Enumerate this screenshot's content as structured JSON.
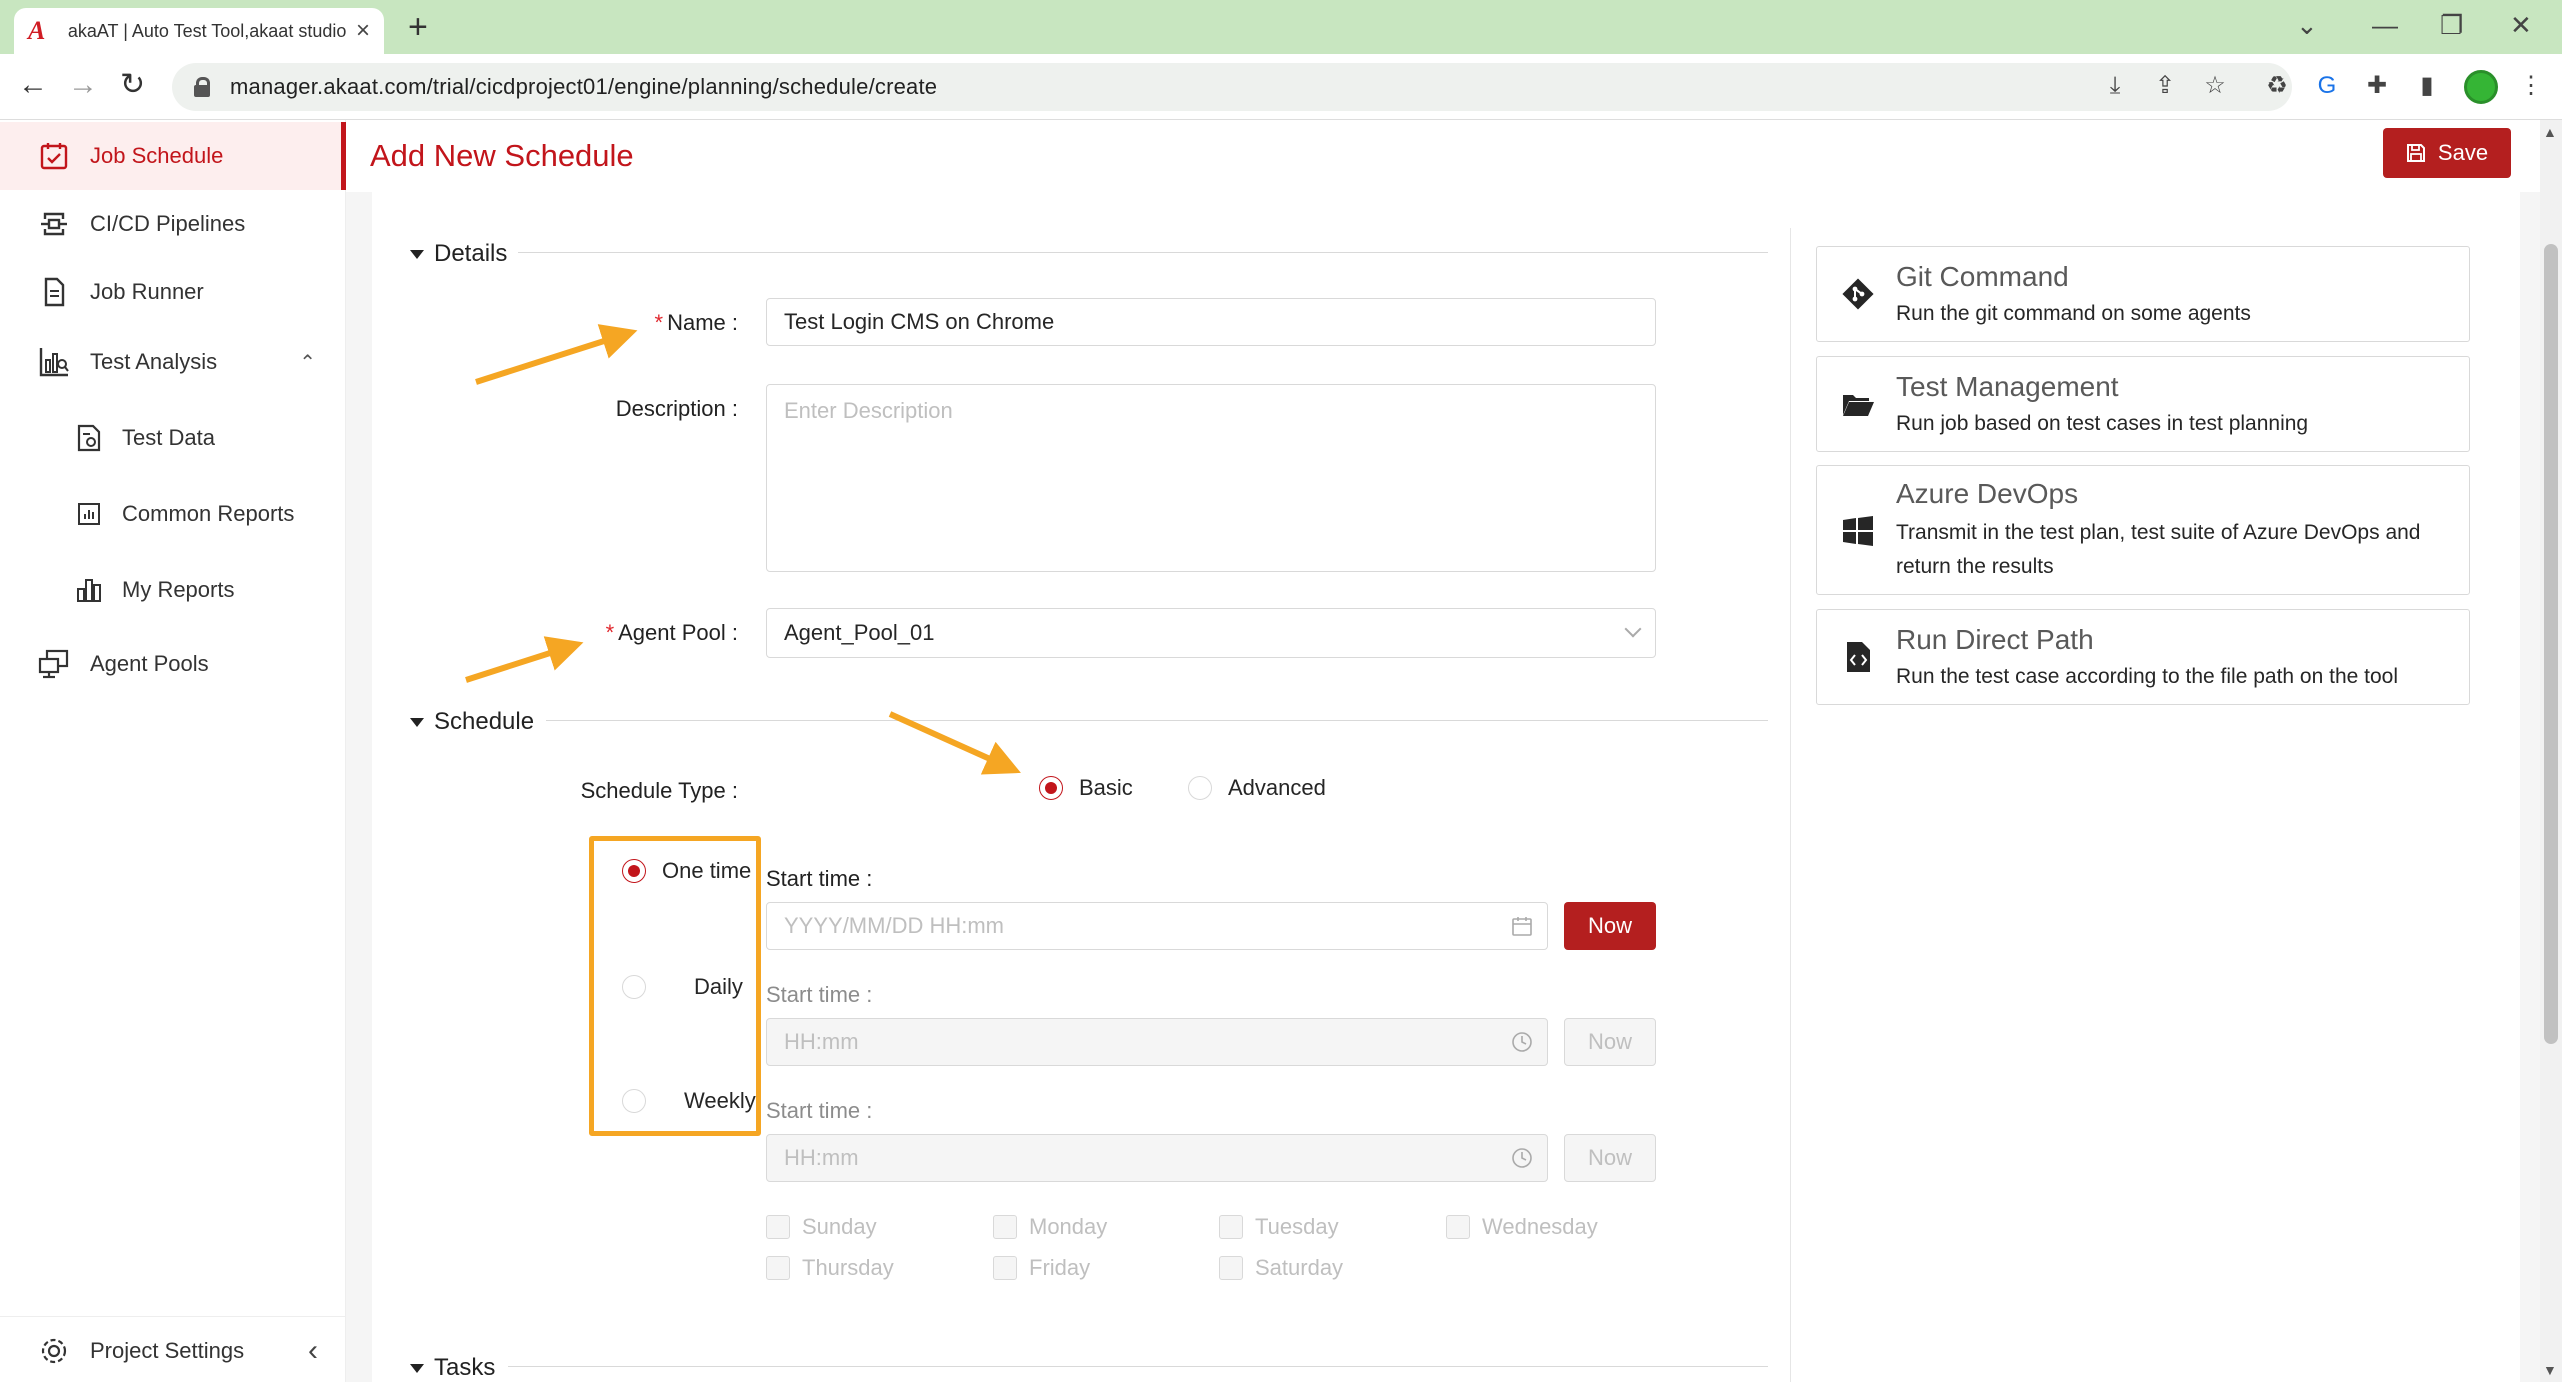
{
  "browser": {
    "tab_title": "akaAT | Auto Test Tool,akaat studio,Web",
    "url": "manager.akaat.com/trial/cicdproject01/engine/planning/schedule/create",
    "new_tab_label": "+",
    "tab_close_label": "×"
  },
  "sidebar": {
    "items": [
      {
        "label": "Job Schedule",
        "icon": "calendar-check-icon"
      },
      {
        "label": "CI/CD Pipelines",
        "icon": "pipeline-icon"
      },
      {
        "label": "Job Runner",
        "icon": "document-icon"
      },
      {
        "label": "Test Analysis",
        "icon": "chart-analysis-icon"
      },
      {
        "label": "Test Data",
        "icon": "data-file-icon"
      },
      {
        "label": "Common Reports",
        "icon": "bar-chart-icon"
      },
      {
        "label": "My Reports",
        "icon": "bar-chart-icon"
      },
      {
        "label": "Agent Pools",
        "icon": "agent-pool-icon"
      }
    ],
    "settings_label": "Project Settings"
  },
  "header": {
    "title": "Add New Schedule",
    "save_label": "Save"
  },
  "details": {
    "section_title": "Details",
    "name_label": "Name",
    "name_value": "Test Login CMS on Chrome",
    "description_label": "Description",
    "description_placeholder": "Enter Description",
    "agent_pool_label": "Agent Pool",
    "agent_pool_value": "Agent_Pool_01"
  },
  "schedule": {
    "section_title": "Schedule",
    "type_label": "Schedule Type",
    "type_options": [
      "Basic",
      "Advanced"
    ],
    "type_selected": "Basic",
    "frequency_options": [
      "One time",
      "Daily",
      "Weekly"
    ],
    "frequency_selected": "One time",
    "start_time_label": "Start time",
    "one_time_placeholder": "YYYY/MM/DD HH:mm",
    "time_placeholder": "HH:mm",
    "now_label": "Now",
    "weekdays": [
      "Sunday",
      "Monday",
      "Tuesday",
      "Wednesday",
      "Thursday",
      "Friday",
      "Saturday"
    ]
  },
  "tasks": {
    "section_title": "Tasks"
  },
  "task_types": [
    {
      "title": "Git Command",
      "desc": "Run the git command on some agents",
      "icon": "git-icon"
    },
    {
      "title": "Test Management",
      "desc": "Run job based on test cases in test planning",
      "icon": "folder-open-icon"
    },
    {
      "title": "Azure DevOps",
      "desc": "Transmit in the test plan, test suite of Azure DevOps and return the results",
      "icon": "windows-icon"
    },
    {
      "title": "Run Direct Path",
      "desc": "Run the test case according to the file path on the tool",
      "icon": "code-file-icon"
    }
  ],
  "colors": {
    "accent": "#c2151b",
    "button_primary": "#b41f1f",
    "annotation_arrow": "#f5a623",
    "tab_bar": "#c8e6c0"
  }
}
